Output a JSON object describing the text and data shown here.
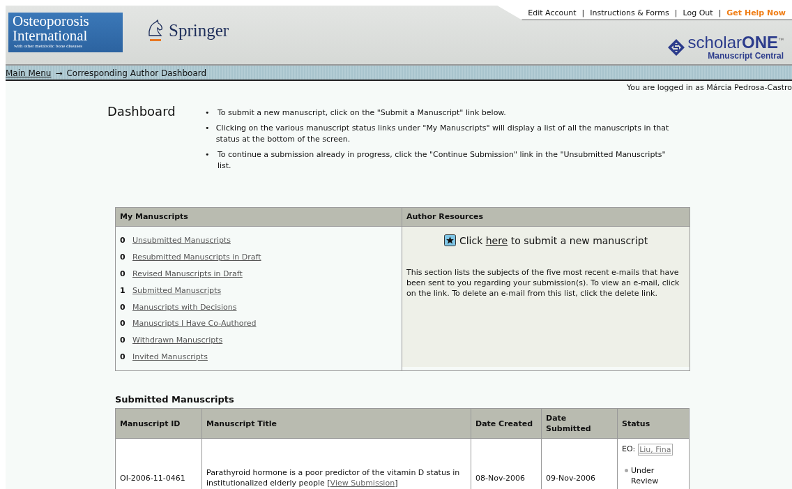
{
  "header": {
    "journal_logo": {
      "line_1": "Osteoporosis",
      "line_2": "International",
      "subtitle": "with other metabolic bone diseases"
    },
    "publisher": "Springer",
    "top_links": [
      {
        "label": "Edit Account",
        "kind": "normal"
      },
      {
        "label": "Instructions & Forms",
        "kind": "normal"
      },
      {
        "label": "Log Out",
        "kind": "normal"
      },
      {
        "label": "Get Help Now",
        "kind": "help"
      }
    ],
    "link_separator": "|",
    "brand": {
      "name_light": "scholar",
      "name_bold": "ONE",
      "trademark": "™",
      "product": "Manuscript Central"
    }
  },
  "breadcrumb": {
    "items": [
      {
        "label": "Main Menu",
        "kind": "link"
      },
      {
        "label": "Corresponding Author Dashboard",
        "kind": "current"
      }
    ],
    "separator": "→"
  },
  "login_status": "You are logged in as Márcia Pedrosa-Castro",
  "dashboard": {
    "title": "Dashboard",
    "bullet": "•",
    "tips": [
      "To submit a new manuscript, click on the \"Submit a Manuscript\" link below.",
      "Clicking on the various manuscript status links under \"My Manuscripts\" will display a list of all the manuscripts in that status at the bottom of the screen.",
      "To continue a submission already in progress, click the \"Continue Submission\" link in the \"Unsubmitted Manuscripts\" list."
    ]
  },
  "my_manuscripts": {
    "title": "My Manuscripts",
    "items": [
      {
        "count": "0",
        "label": "Unsubmitted Manuscripts"
      },
      {
        "count": "0",
        "label": "Resubmitted Manuscripts in Draft"
      },
      {
        "count": "0",
        "label": "Revised Manuscripts in Draft"
      },
      {
        "count": "1",
        "label": "Submitted Manuscripts"
      },
      {
        "count": "0",
        "label": "Manuscripts with Decisions"
      },
      {
        "count": "0",
        "label": "Manuscripts I Have Co-Authored"
      },
      {
        "count": "0",
        "label": "Withdrawn Manuscripts"
      },
      {
        "count": "0",
        "label": "Invited Manuscripts"
      }
    ]
  },
  "author_resources": {
    "title": "Author Resources",
    "submit_before": "Click",
    "submit_link": "here",
    "submit_after": "to submit a new manuscript",
    "note": "This section lists the subjects of the five most recent e-mails that have been sent to you regarding your submission(s). To view an e-mail, click on the link. To delete an e-mail from this list, click the delete link."
  },
  "submitted": {
    "title": "Submitted Manuscripts",
    "columns": [
      "Manuscript ID",
      "Manuscript Title",
      "Date Created",
      "Date Submitted",
      "Status"
    ],
    "rows": [
      {
        "id": "OI-2006-11-0461",
        "title": "Parathyroid hormone is a poor predictor of the vitamin D status in institutionalized elderly people",
        "view_open": "[",
        "view_link": "View Submission",
        "view_close": "]",
        "created": "08-Nov-2006",
        "submitted": "09-Nov-2006",
        "editor_prefix": "EO:",
        "editor": "Liu, Fina",
        "status": "Under Review"
      }
    ]
  }
}
